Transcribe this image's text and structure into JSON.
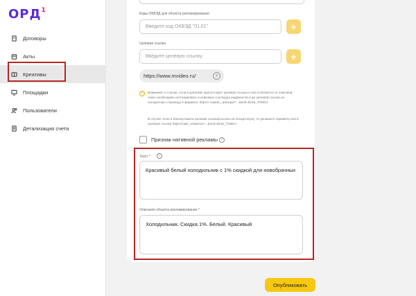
{
  "logo": {
    "text": "ОРД",
    "sup": "1"
  },
  "sidebar": {
    "items": [
      {
        "label": "Договоры",
        "icon": "document-icon"
      },
      {
        "label": "Акты",
        "icon": "calendar-icon"
      },
      {
        "label": "Креативы",
        "icon": "creative-icon",
        "active": true
      },
      {
        "label": "Площадки",
        "icon": "monitor-icon"
      },
      {
        "label": "Пользователи",
        "icon": "users-icon"
      },
      {
        "label": "Детализация счета",
        "icon": "receipt-icon"
      }
    ]
  },
  "form": {
    "okved": {
      "label": "Коды ОКВЭД для объекта рекламирования",
      "placeholder": "Введите код ОКВЭД \"01.01\"",
      "add": "+"
    },
    "target_link": {
      "label": "Целевая ссылка",
      "placeholder": "Введите целевую ссылку",
      "add": "+",
      "chip": "https://www.mvideo.ru/",
      "chip_close": "×"
    },
    "notice": {
      "icon": "!",
      "paragraph1": "Внимание: в случае, если в креативе присутствует целевая ссылка и она отличается от кликовой, токен необходимо интегрировать в кликовую ссылку(до редиректов и до целевой ссылки на посадочную страницу) в формате: https:// сервис_трекера/?...&erid=ВАШ_ТОКЕН",
      "paragraph2": "В случае, если в баннер вшита целевая ссылка(ссылка на посадочную), то допишите параметр erid в целевую ссылку https://сайт_клиента/?...&erid=ВАШ_ТОКЕН"
    },
    "native": {
      "label": "Признак нативной рекламы",
      "info": "i"
    },
    "text": {
      "label": "Текст *",
      "info": "i",
      "value": "Красивый белый холодильник с 1% скидкой для новобрачных"
    },
    "description": {
      "label": "Описание объекта рекламирования *",
      "value": "Холодильник. Скидка 1%.  Белый. Красивый"
    }
  },
  "actions": {
    "publish": "Опубликовать"
  },
  "colors": {
    "accent": "#f6c812",
    "plus_button": "#f7d774",
    "highlight": "#b52424",
    "logo": "#5b2bd9",
    "logo_sup": "#e5177c"
  }
}
